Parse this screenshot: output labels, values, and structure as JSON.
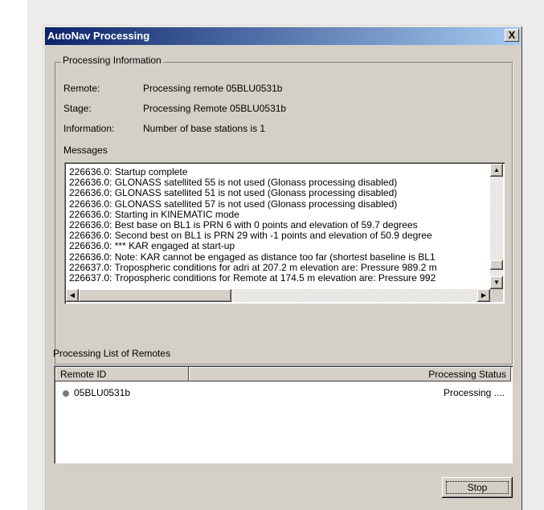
{
  "window": {
    "title": "AutoNav Processing",
    "close_glyph": "X"
  },
  "processing_info": {
    "group_label": "Processing Information",
    "remote_label": "Remote:",
    "remote_value": "Processing remote 05BLU0531b",
    "stage_label": "Stage:",
    "stage_value": "Processing Remote 05BLU0531b",
    "information_label": "Information:",
    "information_value": "Number of base stations is 1",
    "messages_label": "Messages",
    "messages": [
      "226636.0: Startup complete",
      "226636.0: GLONASS satellited 55 is not used (Glonass processing disabled)",
      "226636.0: GLONASS satellited 51 is not used (Glonass processing disabled)",
      "226636.0: GLONASS satellited 57 is not used (Glonass processing disabled)",
      "226636.0: Starting in KINEMATIC mode",
      "226636.0: Best base on BL1 is PRN 6 with 0 points and elevation of 59.7 degrees",
      "226636.0: Second best on BL1 is PRN 29 with -1 points and elevation of 50.9 degree",
      "226636.0: *** KAR engaged at start-up",
      "226636.0: Note: KAR cannot be engaged as distance too far (shortest baseline is BL1",
      "226637.0: Tropospheric conditions for adri at 207.2 m elevation are: Pressure 989.2 m",
      "226637.0: Tropospheric conditions for Remote at 174.5 m elevation are: Pressure 992"
    ]
  },
  "remotes": {
    "section_label": "Processing List of Remotes",
    "columns": [
      "Remote ID",
      "Processing Status"
    ],
    "rows": [
      {
        "id": "05BLU0531b",
        "status": "Processing ...."
      }
    ]
  },
  "buttons": {
    "stop": "Stop"
  },
  "icons": {
    "scroll_up": "▲",
    "scroll_down": "▼",
    "scroll_left": "◀",
    "scroll_right": "▶",
    "status_dot": "status-dot-icon"
  }
}
